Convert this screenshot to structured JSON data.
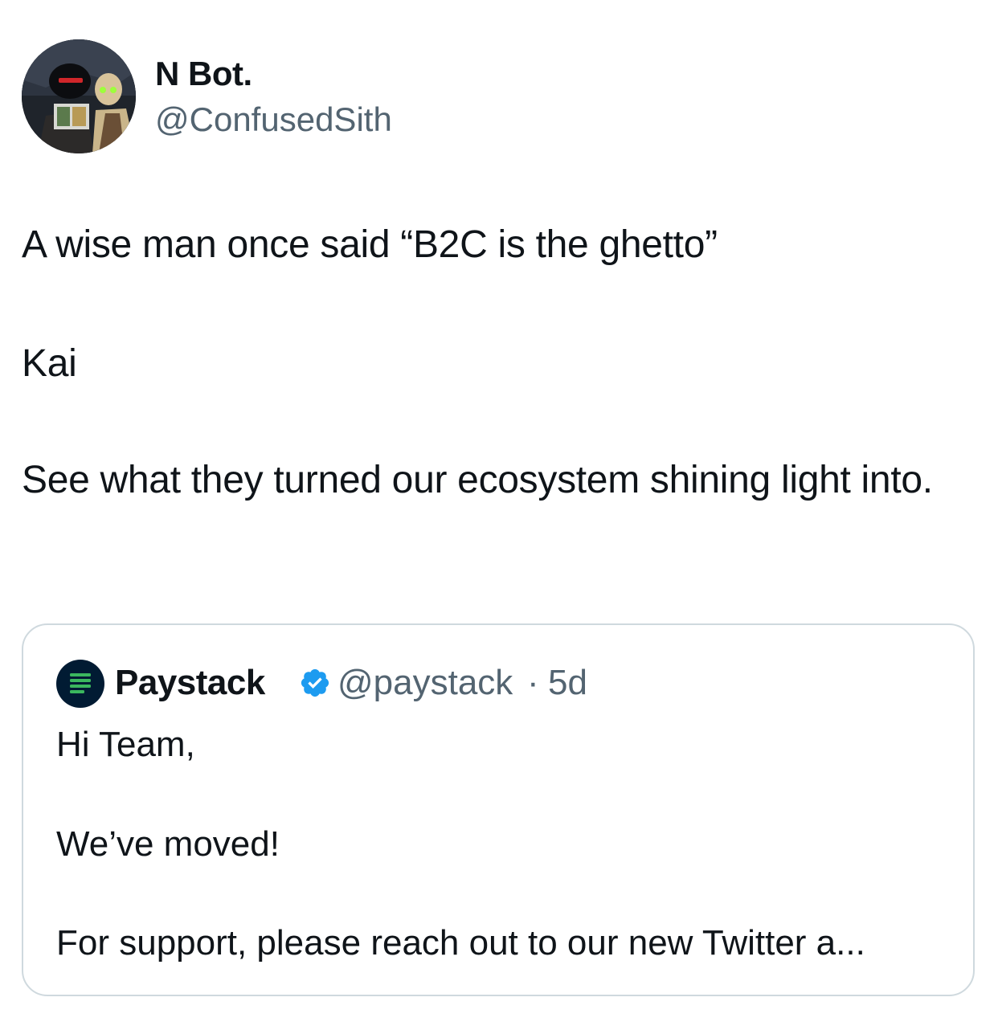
{
  "author": {
    "display_name": "N Bot.",
    "handle": "@ConfusedSith",
    "avatar_icon": "avatar-image"
  },
  "tweet": {
    "lines": [
      "A wise man once said “B2C is the ghetto”",
      "Kai",
      "See what they turned our ecosystem shining light into."
    ]
  },
  "quoted_tweet": {
    "display_name": "Paystack",
    "verified": true,
    "verified_icon": "verified-badge-icon",
    "handle": "@paystack",
    "separator": "·",
    "time": "5d",
    "lines": [
      "Hi Team,",
      "We’ve moved!",
      "For support, please reach out to our new Twitter a..."
    ]
  },
  "colors": {
    "text": "#0f1419",
    "secondary": "#536471",
    "border": "#cfd9de",
    "verified": "#1d9bf0",
    "paystack_logo_bg": "#011b33",
    "paystack_logo_bars": "#3bb75e"
  }
}
